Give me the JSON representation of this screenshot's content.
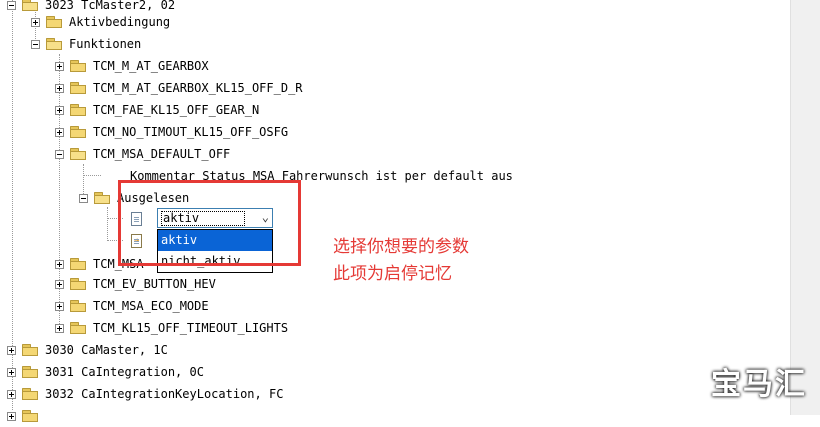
{
  "tree": {
    "rows": [
      {
        "label": "3023 TcMaster2, 02"
      },
      {
        "label": "Aktivbedingung"
      },
      {
        "label": "Funktionen"
      },
      {
        "label": "TCM_M_AT_GEARBOX"
      },
      {
        "label": "TCM_M_AT_GEARBOX_KL15_OFF_D_R"
      },
      {
        "label": "TCM_FAE_KL15_OFF_GEAR_N"
      },
      {
        "label": "TCM_NO_TIMOUT_KL15_OFF_OSFG"
      },
      {
        "label": "TCM_MSA_DEFAULT_OFF"
      },
      {
        "label": "Kommentar Status MSA Fahrerwunsch ist per default aus"
      },
      {
        "label": "Ausgelesen"
      },
      {
        "label": "TCM_MSA"
      },
      {
        "label": "TCM_EV_BUTTON_HEV"
      },
      {
        "label": "TCM_MSA_ECO_MODE"
      },
      {
        "label": "TCM_KL15_OFF_TIMEOUT_LIGHTS"
      },
      {
        "label": "3030 CaMaster, 1C"
      },
      {
        "label": "3031 CaIntegration, 0C"
      },
      {
        "label": "3032 CaIntegrationKeyLocation, FC"
      }
    ]
  },
  "combo": {
    "value": "aktiv",
    "options": [
      "aktiv",
      "nicht_aktiv"
    ]
  },
  "annotation": {
    "line1": "选择你想要的参数",
    "line2": "此项为启停记忆"
  },
  "watermark": "宝马汇",
  "colors": {
    "selection": "#0a64d6",
    "annotation": "#e53935",
    "folder": "#f4d774"
  }
}
